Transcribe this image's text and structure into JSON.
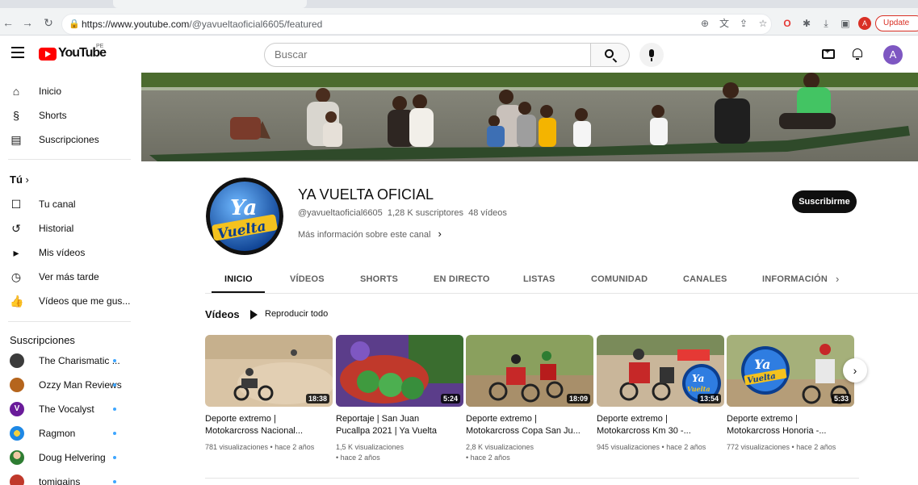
{
  "browser": {
    "url_host": "https://www.youtube.com",
    "url_path": "/@yavueltaoficial6605/featured",
    "profile_initial": "A",
    "update_label": "Update"
  },
  "header": {
    "logo_text": "YouTube",
    "region": "PE",
    "search_placeholder": "Buscar",
    "avatar_initial": "A"
  },
  "sidebar": {
    "main": [
      {
        "label": "Inicio",
        "icon": "home-icon"
      },
      {
        "label": "Shorts",
        "icon": "shorts-icon"
      },
      {
        "label": "Suscripciones",
        "icon": "subscriptions-icon"
      }
    ],
    "you_heading": "Tú",
    "you": [
      {
        "label": "Tu canal",
        "icon": "channel-icon"
      },
      {
        "label": "Historial",
        "icon": "history-icon"
      },
      {
        "label": "Mis vídeos",
        "icon": "my-videos-icon"
      },
      {
        "label": "Ver más tarde",
        "icon": "watch-later-icon"
      },
      {
        "label": "Vídeos que me gus...",
        "icon": "like-icon"
      }
    ],
    "subs_heading": "Suscripciones",
    "subs": [
      {
        "label": "The Charismatic ...",
        "color": "#3b3b3b"
      },
      {
        "label": "Ozzy Man Reviews",
        "color": "#b5651d"
      },
      {
        "label": "The Vocalyst",
        "color": "#6a1b9a"
      },
      {
        "label": "Ragmon",
        "color": "#1e88e5"
      },
      {
        "label": "Doug Helvering",
        "color": "#8d6e63"
      },
      {
        "label": "tomjgains",
        "color": "#c0392b"
      }
    ]
  },
  "channel": {
    "name": "YA VUELTA OFICIAL",
    "handle": "@yavueltaoficial6605",
    "subscribers": "1,28 K suscriptores",
    "videos_count": "48 vídeos",
    "more_info": "Más información sobre este canal",
    "subscribe_label": "Suscribirme",
    "avatar_text_1": "Ya",
    "avatar_text_2": "Vuelta"
  },
  "tabs": [
    "INICIO",
    "VÍDEOS",
    "SHORTS",
    "EN DIRECTO",
    "LISTAS",
    "COMUNIDAD",
    "CANALES",
    "INFORMACIÓN"
  ],
  "section": {
    "title": "Vídeos",
    "play_all": "Reproducir todo"
  },
  "videos": [
    {
      "title_1": "Deporte extremo |",
      "title_2": "Motokarcross Nacional...",
      "meta_1": "781 visualizaciones • hace 2 años",
      "meta_2": "",
      "duration": "18:38"
    },
    {
      "title_1": "Reportaje | San Juan",
      "title_2": "Pucallpa 2021 | Ya Vuelta",
      "meta_1": "1,5 K visualizaciones",
      "meta_2": "• hace 2 años",
      "duration": "5:24"
    },
    {
      "title_1": "Deporte extremo |",
      "title_2": "Motokarcross Copa San Ju...",
      "meta_1": "2,8 K visualizaciones",
      "meta_2": "• hace 2 años",
      "duration": "18:09"
    },
    {
      "title_1": "Deporte extremo |",
      "title_2": "Motokarcross Km 30 -...",
      "meta_1": "945 visualizaciones • hace 2 años",
      "meta_2": "",
      "duration": "13:54"
    },
    {
      "title_1": "Deporte extremo |",
      "title_2": "Motokarcross Honoria -...",
      "meta_1": "772 visualizaciones • hace 2 años",
      "meta_2": "",
      "duration": "5:33"
    }
  ],
  "colors": {
    "brand_red": "#ff0000",
    "subscribe_bg": "#0f0f0f",
    "avatar_purple": "#7e57c2"
  }
}
